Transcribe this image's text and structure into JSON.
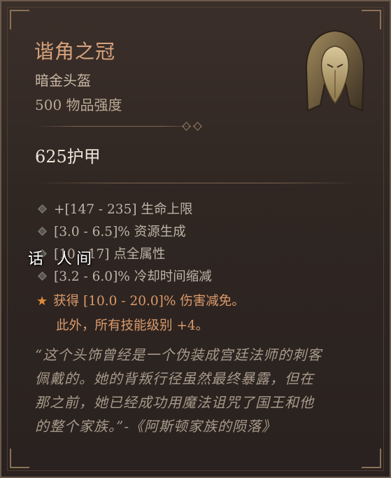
{
  "item": {
    "name": "谐角之冠",
    "type": "暗金头盔",
    "item_power": "500 物品强度",
    "armor": "625护甲"
  },
  "affixes": [
    "+[147 - 235] 生命上限",
    "[3.0 - 6.5]% 资源生成",
    "[10 - 17] 点全属性",
    "[3.2 - 6.0]% 冷却时间缩减"
  ],
  "unique_power": {
    "line1": "获得 [10.0 - 20.0]% 伤害减免。",
    "line2": "此外，所有技能级别 +4。",
    "icon": "star-icon"
  },
  "flavor_text": [
    "“这个头饰曾经是一个伪装成宫廷法师的刺客",
    "佩戴的。她的背叛行径虽然最终暴露，但在",
    "那之前，她已经成功用魔法诅咒了国王和他",
    "的整个家族。”-《阿斯顿家族的陨落》"
  ],
  "watermark": "话 人间",
  "colors": {
    "title": "#d7a37c",
    "unique": "#dc9a6a",
    "affix": "#bdb3a6",
    "armor": "#ece4d8"
  }
}
